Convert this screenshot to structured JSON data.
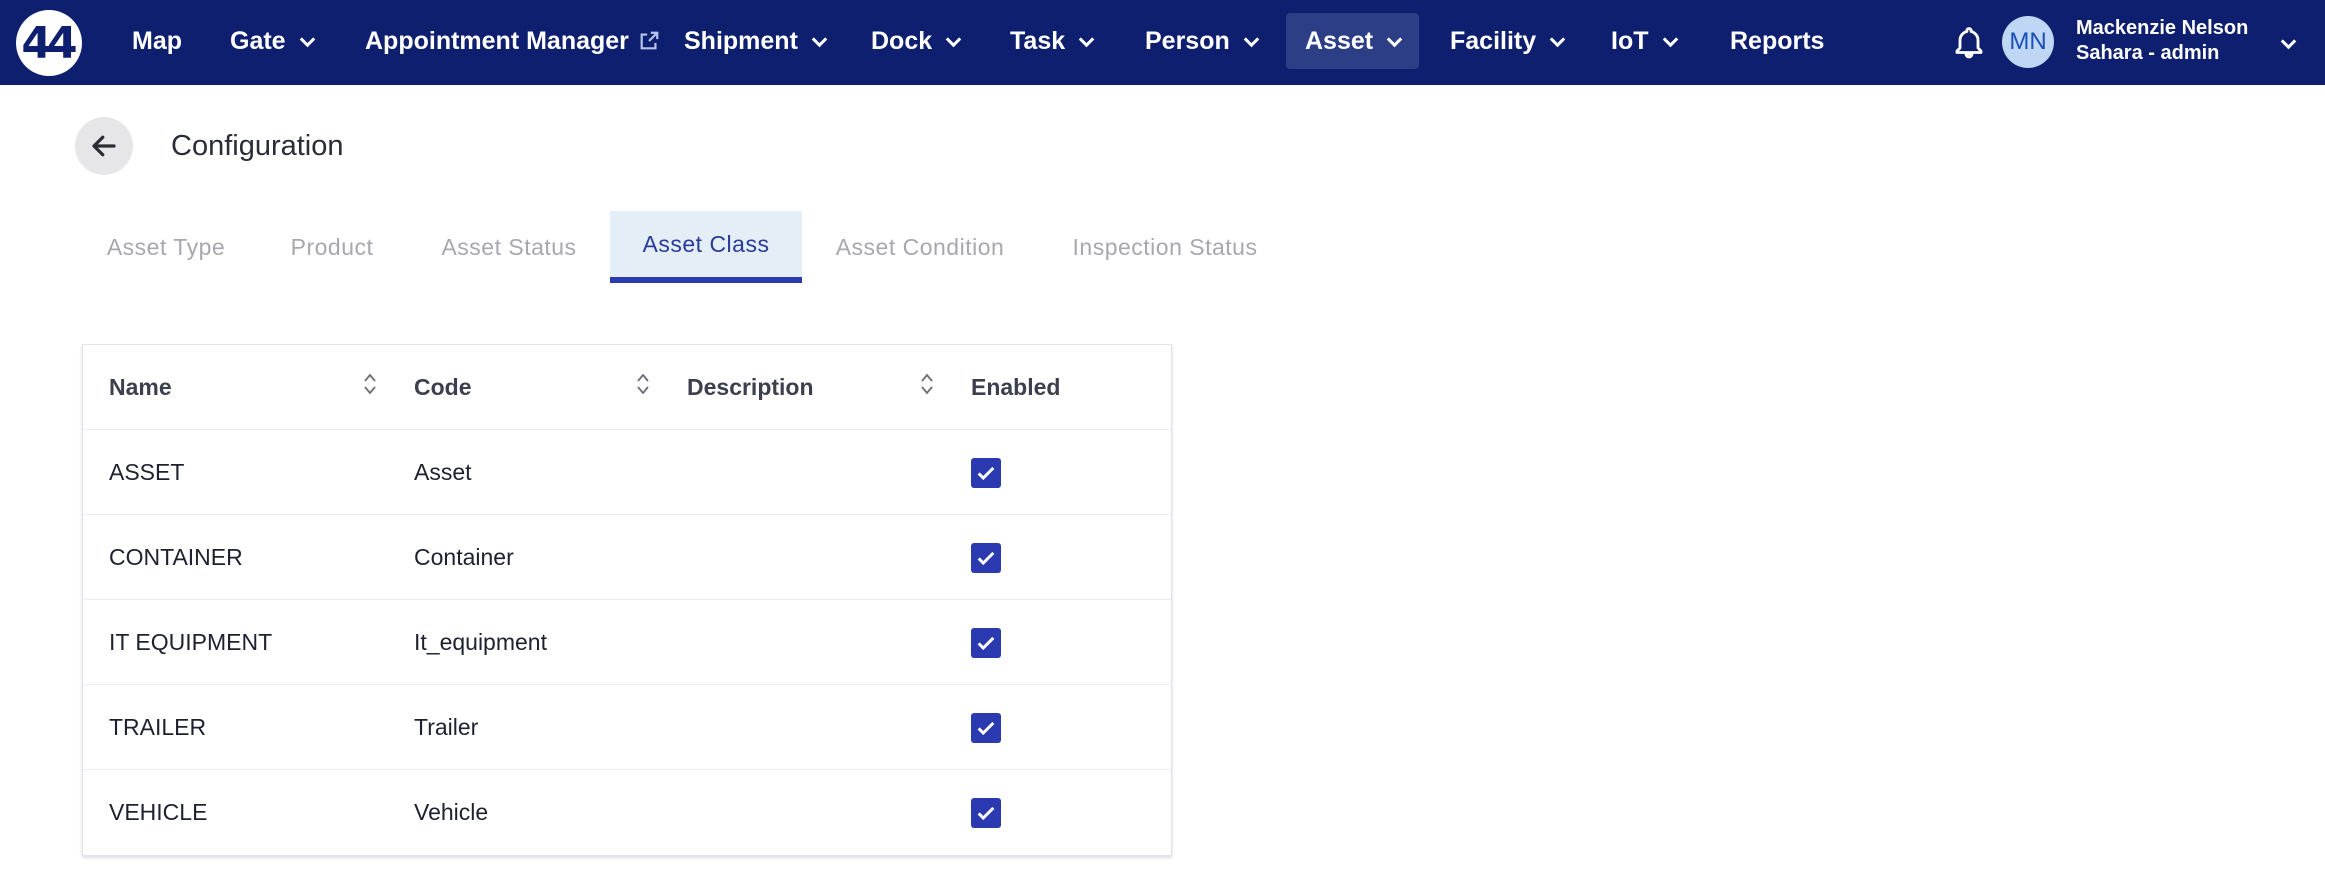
{
  "logo": {
    "text": "44"
  },
  "nav": {
    "items": [
      {
        "label": "Map"
      },
      {
        "label": "Gate"
      },
      {
        "label": "Appointment Manager"
      },
      {
        "label": "Shipment"
      },
      {
        "label": "Dock"
      },
      {
        "label": "Task"
      },
      {
        "label": "Person"
      },
      {
        "label": "Asset"
      },
      {
        "label": "Facility"
      },
      {
        "label": "IoT"
      },
      {
        "label": "Reports"
      }
    ],
    "active": "Asset"
  },
  "user": {
    "initials": "MN",
    "name": "Mackenzie Nelson",
    "role": "Sahara - admin"
  },
  "page": {
    "title": "Configuration"
  },
  "tabs": {
    "items": [
      {
        "label": "Asset Type"
      },
      {
        "label": "Product"
      },
      {
        "label": "Asset Status"
      },
      {
        "label": "Asset Class"
      },
      {
        "label": "Asset Condition"
      },
      {
        "label": "Inspection Status"
      }
    ],
    "active": "Asset Class"
  },
  "table": {
    "columns": [
      {
        "label": "Name"
      },
      {
        "label": "Code"
      },
      {
        "label": "Description"
      },
      {
        "label": "Enabled"
      }
    ],
    "rows": [
      {
        "name": "ASSET",
        "code": "Asset",
        "description": "",
        "enabled": true
      },
      {
        "name": "CONTAINER",
        "code": "Container",
        "description": "",
        "enabled": true
      },
      {
        "name": "IT EQUIPMENT",
        "code": "It_equipment",
        "description": "",
        "enabled": true
      },
      {
        "name": "TRAILER",
        "code": "Trailer",
        "description": "",
        "enabled": true
      },
      {
        "name": "VEHICLE",
        "code": "Vehicle",
        "description": "",
        "enabled": true
      }
    ]
  },
  "colors": {
    "navbar": "#0d1f6e",
    "accent": "#2b3ab0",
    "active_tab_bg": "#e3eef7"
  }
}
